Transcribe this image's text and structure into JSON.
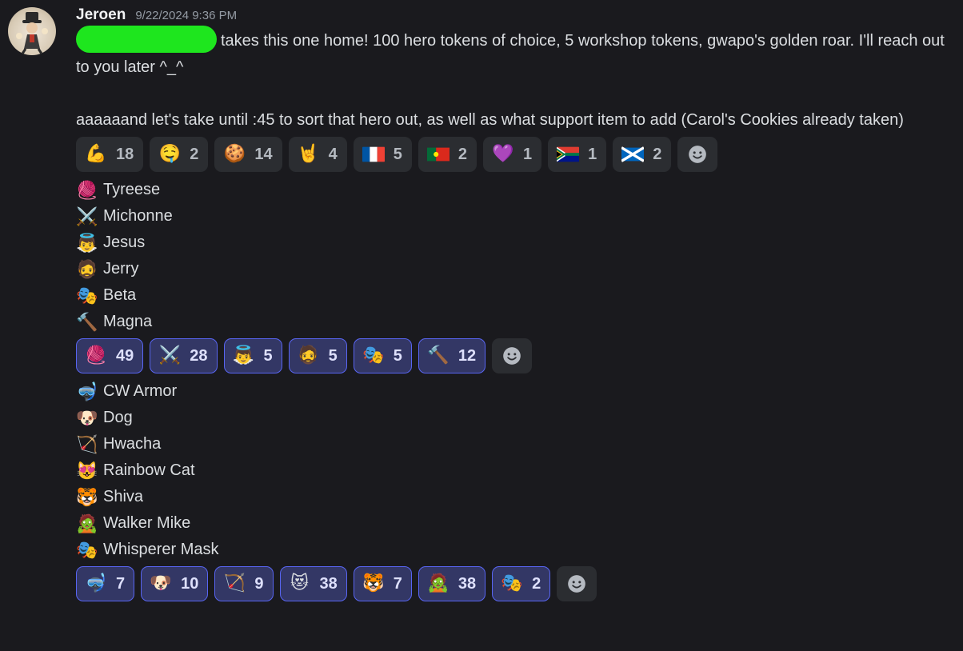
{
  "message": {
    "author": "Jeroen",
    "timestamp": "9/22/2024 9:36 PM",
    "text": "takes this one home! 100 hero tokens of choice, 5 workshop tokens, gwapo's golden roar. I'll reach out to you later ^_^\n\naaaaaand let's take until :45 to sort that hero out, as well as what support item to add (Carol's Cookies already taken)"
  },
  "reactions_1": [
    {
      "emoji": "💪",
      "count": "18",
      "name": "flexed-biceps-icon",
      "me": false
    },
    {
      "emoji": "🤤",
      "count": "2",
      "name": "drooling-face-icon",
      "me": false
    },
    {
      "emoji": "🍪",
      "count": "14",
      "name": "cookie-icon",
      "me": false
    },
    {
      "emoji": "🤘",
      "count": "4",
      "name": "rock-hand-icon",
      "me": false
    },
    {
      "emoji": "flag-fr",
      "count": "5",
      "name": "flag-france-icon",
      "me": false
    },
    {
      "emoji": "flag-pt",
      "count": "2",
      "name": "flag-portugal-icon",
      "me": false
    },
    {
      "emoji": "💜",
      "count": "1",
      "name": "purple-heart-icon",
      "me": false
    },
    {
      "emoji": "flag-za",
      "count": "1",
      "name": "flag-south-africa-icon",
      "me": false
    },
    {
      "emoji": "flag-sc",
      "count": "2",
      "name": "flag-scotland-icon",
      "me": false
    }
  ],
  "heroes": [
    {
      "emoji": "🧶",
      "label": "Tyreese"
    },
    {
      "emoji": "⚔️",
      "label": "Michonne"
    },
    {
      "emoji": "👼",
      "label": "Jesus"
    },
    {
      "emoji": "🧔",
      "label": "Jerry"
    },
    {
      "emoji": "🎭",
      "label": "Beta"
    },
    {
      "emoji": "🔨",
      "label": "Magna"
    }
  ],
  "reactions_2": [
    {
      "emoji": "🧶",
      "count": "49",
      "name": "yarn-icon",
      "me": true
    },
    {
      "emoji": "⚔️",
      "count": "28",
      "name": "crossed-swords-icon",
      "me": true
    },
    {
      "emoji": "👼",
      "count": "5",
      "name": "baby-angel-icon",
      "me": true
    },
    {
      "emoji": "🧔",
      "count": "5",
      "name": "bearded-person-icon",
      "me": true
    },
    {
      "emoji": "🎭",
      "count": "5",
      "name": "performing-arts-icon",
      "me": true
    },
    {
      "emoji": "🔨",
      "count": "12",
      "name": "hammer-icon",
      "me": true
    }
  ],
  "items": [
    {
      "emoji": "🤿",
      "label": "CW Armor"
    },
    {
      "emoji": "🐶",
      "label": "Dog"
    },
    {
      "emoji": "🏹",
      "label": "Hwacha"
    },
    {
      "emoji": "😻",
      "label": "Rainbow Cat"
    },
    {
      "emoji": "🐯",
      "label": "Shiva"
    },
    {
      "emoji": "🧟",
      "label": "Walker Mike"
    },
    {
      "emoji": "🎭",
      "label": "Whisperer Mask"
    }
  ],
  "reactions_3": [
    {
      "emoji": "🤿",
      "count": "7",
      "name": "diving-mask-icon",
      "me": true
    },
    {
      "emoji": "🐶",
      "count": "10",
      "name": "dog-face-icon",
      "me": true
    },
    {
      "emoji": "🏹",
      "count": "9",
      "name": "bow-and-arrow-icon",
      "me": true
    },
    {
      "emoji": "😻",
      "count": "38",
      "name": "heart-eyes-cat-icon",
      "me": true
    },
    {
      "emoji": "🐯",
      "count": "7",
      "name": "tiger-face-icon",
      "me": true
    },
    {
      "emoji": "🧟",
      "count": "38",
      "name": "zombie-icon",
      "me": true
    },
    {
      "emoji": "🎭",
      "count": "2",
      "name": "performing-arts-icon",
      "me": true
    }
  ],
  "colors": {
    "background": "#1a1a1e",
    "reaction_bg": "#2b2d31",
    "reaction_me_bg": "#333765",
    "reaction_me_border": "#5865f2",
    "redaction": "#1ee61e"
  }
}
